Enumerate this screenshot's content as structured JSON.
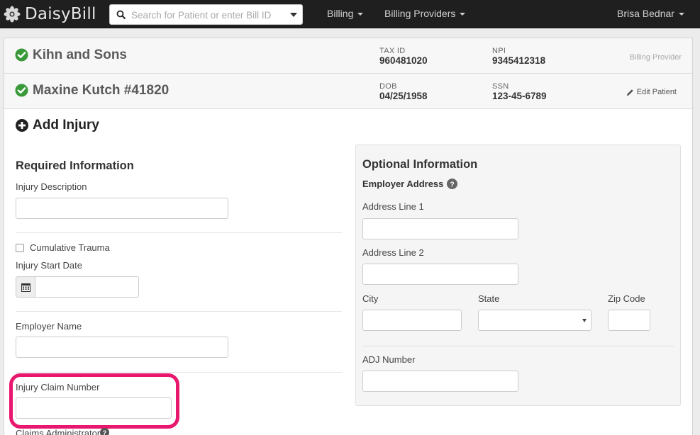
{
  "brand": {
    "name": "DaisyBill"
  },
  "search": {
    "placeholder": "Search for Patient or enter Bill ID"
  },
  "nav": {
    "billing": "Billing",
    "billing_providers": "Billing Providers",
    "user": "Brisa Bednar"
  },
  "provider": {
    "name": "Kihn and Sons",
    "tax_id_label": "TAX ID",
    "tax_id": "960481020",
    "npi_label": "NPI",
    "npi": "9345412318",
    "role": "Billing Provider"
  },
  "patient": {
    "name": "Maxine Kutch #41820",
    "dob_label": "DOB",
    "dob": "04/25/1958",
    "ssn_label": "SSN",
    "ssn": "123-45-6789",
    "edit_label": "Edit Patient"
  },
  "form": {
    "title": "Add Injury",
    "required": {
      "title": "Required Information",
      "injury_description": "Injury Description",
      "cumulative_trauma": "Cumulative Trauma",
      "injury_start_date": "Injury Start Date",
      "employer_name": "Employer Name",
      "injury_claim_number": "Injury Claim Number",
      "claims_administrator": "Claims Administrator"
    },
    "optional": {
      "title": "Optional Information",
      "employer_address": "Employer Address",
      "address_line_1": "Address Line 1",
      "address_line_2": "Address Line 2",
      "city": "City",
      "state": "State",
      "zip": "Zip Code",
      "adj_number": "ADJ Number"
    }
  },
  "colors": {
    "navbar": "#1f1f1f",
    "check": "#3a9a3a",
    "highlight": "#e8186e"
  },
  "icons": [
    "daisy-logo-icon",
    "search-icon",
    "check-circle-icon",
    "pencil-icon",
    "plus-circle-icon",
    "calendar-icon",
    "question-circle-icon"
  ]
}
